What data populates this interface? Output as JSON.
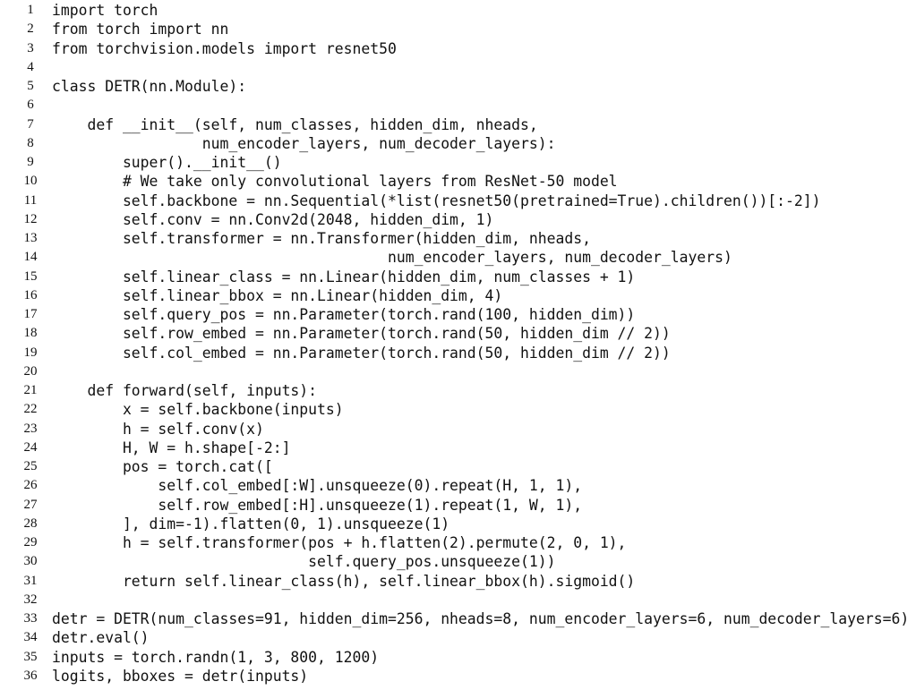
{
  "colors": {
    "keyword": "#008000",
    "name": "#0000ff",
    "number": "#666666",
    "operator": "#666666",
    "comment": "#408080"
  },
  "lines": [
    "import torch",
    "from torch import nn",
    "from torchvision.models import resnet50",
    "",
    "class DETR(nn.Module):",
    "",
    "    def __init__(self, num_classes, hidden_dim, nheads,",
    "                 num_encoder_layers, num_decoder_layers):",
    "        super().__init__()",
    "        # We take only convolutional layers from ResNet-50 model",
    "        self.backbone = nn.Sequential(*list(resnet50(pretrained=True).children())[:-2])",
    "        self.conv = nn.Conv2d(2048, hidden_dim, 1)",
    "        self.transformer = nn.Transformer(hidden_dim, nheads,",
    "                                      num_encoder_layers, num_decoder_layers)",
    "        self.linear_class = nn.Linear(hidden_dim, num_classes + 1)",
    "        self.linear_bbox = nn.Linear(hidden_dim, 4)",
    "        self.query_pos = nn.Parameter(torch.rand(100, hidden_dim))",
    "        self.row_embed = nn.Parameter(torch.rand(50, hidden_dim // 2))",
    "        self.col_embed = nn.Parameter(torch.rand(50, hidden_dim // 2))",
    "",
    "    def forward(self, inputs):",
    "        x = self.backbone(inputs)",
    "        h = self.conv(x)",
    "        H, W = h.shape[-2:]",
    "        pos = torch.cat([",
    "            self.col_embed[:W].unsqueeze(0).repeat(H, 1, 1),",
    "            self.row_embed[:H].unsqueeze(1).repeat(1, W, 1),",
    "        ], dim=-1).flatten(0, 1).unsqueeze(1)",
    "        h = self.transformer(pos + h.flatten(2).permute(2, 0, 1),",
    "                             self.query_pos.unsqueeze(1))",
    "        return self.linear_class(h), self.linear_bbox(h).sigmoid()",
    "",
    "detr = DETR(num_classes=91, hidden_dim=256, nheads=8, num_encoder_layers=6, num_decoder_layers=6)",
    "detr.eval()",
    "inputs = torch.randn(1, 3, 800, 1200)",
    "logits, bboxes = detr(inputs)"
  ]
}
